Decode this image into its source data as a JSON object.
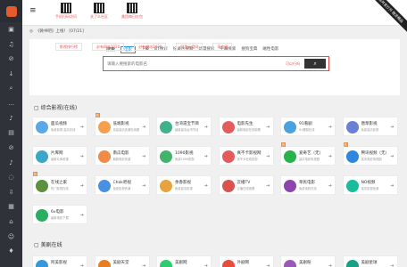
{
  "topbar": {
    "qr_items": [
      {
        "label": "手机扫码访问"
      },
      {
        "label": "关了么社区"
      },
      {
        "label": "美团每日红包"
      }
    ],
    "ribbon": "高并发打开 稳定精品"
  },
  "notice": "《微书吧》上线！ [07/21]",
  "search": {
    "lead": "搜索",
    "categories": [
      "电影",
      "下载",
      "BT搜索",
      "纪录片搜索",
      "动漫搜索",
      "字幕搜索",
      "搜狗宝典",
      "磁性电影"
    ],
    "placeholder": "请输入要搜索的电影名",
    "hint": "可以行吗",
    "button_icon": "search-icon"
  },
  "quick_links": [
    "影视排行榜",
    "必有网站2020",
    "必有網站2020",
    "阿里云盘网",
    "采片网"
  ],
  "section1_title": "综合影视(在线)",
  "section2_title": "美剧在线",
  "tiles": [
    {
      "name": "面瓜视频",
      "desc": "免费影视 高清在线",
      "color": "#5aa9e6",
      "tag": ""
    },
    {
      "name": "低端影视",
      "desc": "精品高清资源在线看",
      "color": "#f6a04d",
      "tag": "热"
    },
    {
      "name": "台湾遗宝节目",
      "desc": "最新高清台湾节目",
      "color": "#3fb28a",
      "tag": ""
    },
    {
      "name": "电影先生",
      "desc": "最新电影在线观看",
      "color": "#e25d5d",
      "tag": ""
    },
    {
      "name": "91看剧",
      "desc": "91看剧在线",
      "color": "#4aa3df",
      "tag": ""
    },
    {
      "name": "唐草影视",
      "desc": "免费高清影视",
      "color": "#6b7fd7",
      "tag": ""
    },
    {
      "name": "片库网",
      "desc": "最新片库资源",
      "color": "#3aa7c7",
      "tag": ""
    },
    {
      "name": "南瓜电影",
      "desc": "最新电影资源",
      "color": "#f08b4a",
      "tag": ""
    },
    {
      "name": "1090影视",
      "desc": "免费1090影视",
      "color": "#43b36a",
      "tag": ""
    },
    {
      "name": "真不卡影视网",
      "desc": "真不卡在线影视",
      "color": "#e55b5b",
      "tag": ""
    },
    {
      "name": "爱奇艺（无）",
      "desc": "高清电影电视剧",
      "color": "#28b34a",
      "tag": "热"
    },
    {
      "name": "腾讯视频（无）",
      "desc": "高清电影电视剧",
      "color": "#2e86de",
      "tag": "热"
    },
    {
      "name": "在线之家",
      "desc": "热门影视在线",
      "color": "#5c8f3e",
      "tag": "热"
    },
    {
      "name": "Chok吧视",
      "desc": "免费影视资源",
      "color": "#4a90e2",
      "tag": ""
    },
    {
      "name": "余香影视",
      "desc": "免费高清影视",
      "color": "#e7a33e",
      "tag": ""
    },
    {
      "name": "云播TV",
      "desc": "云播在线观看",
      "color": "#d9534f",
      "tag": ""
    },
    {
      "name": "草民电影",
      "desc": "免费电影在线",
      "color": "#8e44ad",
      "tag": ""
    },
    {
      "name": "NO视频",
      "desc": "高清影视资源",
      "color": "#1abc9c",
      "tag": ""
    },
    {
      "name": "6v电影",
      "desc": "最新电影下载",
      "color": "#27ae60",
      "tag": ""
    }
  ],
  "tiles2": [
    {
      "name": "阿美影视",
      "desc": "",
      "color": "#3498db"
    },
    {
      "name": "美剧天堂",
      "desc": "",
      "color": "#e67e22"
    },
    {
      "name": "美剧网",
      "desc": "",
      "color": "#2ecc71"
    },
    {
      "name": "外剧网",
      "desc": "",
      "color": "#e74c3c"
    },
    {
      "name": "美剧粉",
      "desc": "",
      "color": "#9b59b6"
    },
    {
      "name": "美剧星球",
      "desc": "",
      "color": "#16a085"
    }
  ]
}
